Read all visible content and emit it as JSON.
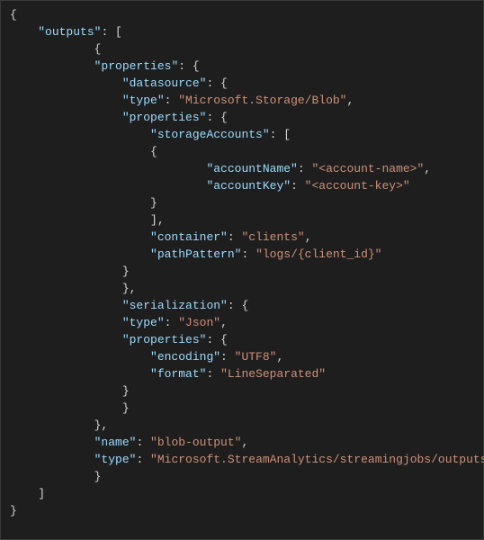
{
  "lines": [
    {
      "indent": 0,
      "tokens": [
        {
          "t": "p",
          "v": "{"
        }
      ]
    },
    {
      "indent": 1,
      "tokens": [
        {
          "t": "k",
          "v": "\"outputs\""
        },
        {
          "t": "p",
          "v": ": ["
        }
      ]
    },
    {
      "indent": 3,
      "tokens": [
        {
          "t": "p",
          "v": "{"
        }
      ]
    },
    {
      "indent": 3,
      "tokens": [
        {
          "t": "k",
          "v": "\"properties\""
        },
        {
          "t": "p",
          "v": ": {"
        }
      ]
    },
    {
      "indent": 4,
      "tokens": [
        {
          "t": "k",
          "v": "\"datasource\""
        },
        {
          "t": "p",
          "v": ": {"
        }
      ]
    },
    {
      "indent": 4,
      "tokens": [
        {
          "t": "k",
          "v": "\"type\""
        },
        {
          "t": "p",
          "v": ": "
        },
        {
          "t": "s",
          "v": "\"Microsoft.Storage/Blob\""
        },
        {
          "t": "p",
          "v": ","
        }
      ]
    },
    {
      "indent": 4,
      "tokens": [
        {
          "t": "k",
          "v": "\"properties\""
        },
        {
          "t": "p",
          "v": ": {"
        }
      ]
    },
    {
      "indent": 5,
      "tokens": [
        {
          "t": "k",
          "v": "\"storageAccounts\""
        },
        {
          "t": "p",
          "v": ": ["
        }
      ]
    },
    {
      "indent": 5,
      "tokens": [
        {
          "t": "p",
          "v": "{"
        }
      ]
    },
    {
      "indent": 7,
      "tokens": [
        {
          "t": "k",
          "v": "\"accountName\""
        },
        {
          "t": "p",
          "v": ": "
        },
        {
          "t": "s",
          "v": "\"<account-name>\""
        },
        {
          "t": "p",
          "v": ","
        }
      ]
    },
    {
      "indent": 7,
      "tokens": [
        {
          "t": "k",
          "v": "\"accountKey\""
        },
        {
          "t": "p",
          "v": ": "
        },
        {
          "t": "s",
          "v": "\"<account-key>\""
        }
      ]
    },
    {
      "indent": 5,
      "tokens": [
        {
          "t": "p",
          "v": "}"
        }
      ]
    },
    {
      "indent": 5,
      "tokens": [
        {
          "t": "p",
          "v": "],"
        }
      ]
    },
    {
      "indent": 5,
      "tokens": [
        {
          "t": "k",
          "v": "\"container\""
        },
        {
          "t": "p",
          "v": ": "
        },
        {
          "t": "s",
          "v": "\"clients\""
        },
        {
          "t": "p",
          "v": ","
        }
      ]
    },
    {
      "indent": 5,
      "tokens": [
        {
          "t": "k",
          "v": "\"pathPattern\""
        },
        {
          "t": "p",
          "v": ": "
        },
        {
          "t": "s",
          "v": "\"logs/{client_id}\""
        }
      ]
    },
    {
      "indent": 4,
      "tokens": [
        {
          "t": "p",
          "v": "}"
        }
      ]
    },
    {
      "indent": 4,
      "tokens": [
        {
          "t": "p",
          "v": "},"
        }
      ]
    },
    {
      "indent": 4,
      "tokens": [
        {
          "t": "k",
          "v": "\"serialization\""
        },
        {
          "t": "p",
          "v": ": {"
        }
      ]
    },
    {
      "indent": 4,
      "tokens": [
        {
          "t": "k",
          "v": "\"type\""
        },
        {
          "t": "p",
          "v": ": "
        },
        {
          "t": "s",
          "v": "\"Json\""
        },
        {
          "t": "p",
          "v": ","
        }
      ]
    },
    {
      "indent": 4,
      "tokens": [
        {
          "t": "k",
          "v": "\"properties\""
        },
        {
          "t": "p",
          "v": ": {"
        }
      ]
    },
    {
      "indent": 5,
      "tokens": [
        {
          "t": "k",
          "v": "\"encoding\""
        },
        {
          "t": "p",
          "v": ": "
        },
        {
          "t": "s",
          "v": "\"UTF8\""
        },
        {
          "t": "p",
          "v": ","
        }
      ]
    },
    {
      "indent": 5,
      "tokens": [
        {
          "t": "k",
          "v": "\"format\""
        },
        {
          "t": "p",
          "v": ": "
        },
        {
          "t": "s",
          "v": "\"LineSeparated\""
        }
      ]
    },
    {
      "indent": 4,
      "tokens": [
        {
          "t": "p",
          "v": "}"
        }
      ]
    },
    {
      "indent": 4,
      "tokens": [
        {
          "t": "p",
          "v": "}"
        }
      ]
    },
    {
      "indent": 3,
      "tokens": [
        {
          "t": "p",
          "v": "},"
        }
      ]
    },
    {
      "indent": 3,
      "tokens": [
        {
          "t": "k",
          "v": "\"name\""
        },
        {
          "t": "p",
          "v": ": "
        },
        {
          "t": "s",
          "v": "\"blob-output\""
        },
        {
          "t": "p",
          "v": ","
        }
      ]
    },
    {
      "indent": 3,
      "tokens": [
        {
          "t": "k",
          "v": "\"type\""
        },
        {
          "t": "p",
          "v": ": "
        },
        {
          "t": "s",
          "v": "\"Microsoft.StreamAnalytics/streamingjobs/outputs\""
        }
      ]
    },
    {
      "indent": 3,
      "tokens": [
        {
          "t": "p",
          "v": "}"
        }
      ]
    },
    {
      "indent": 1,
      "tokens": [
        {
          "t": "p",
          "v": "]"
        }
      ]
    },
    {
      "indent": 0,
      "tokens": [
        {
          "t": "p",
          "v": "}"
        }
      ]
    }
  ],
  "indent_unit": "    "
}
